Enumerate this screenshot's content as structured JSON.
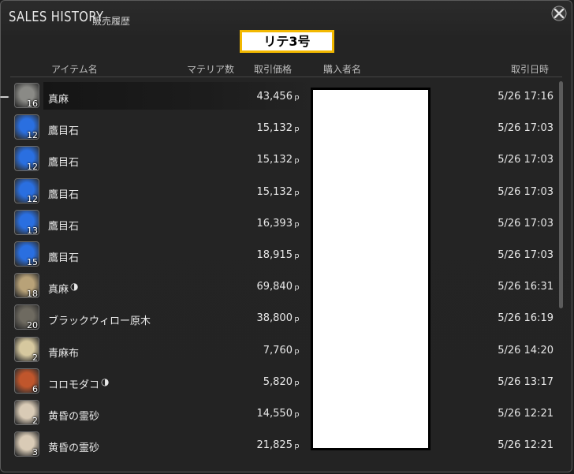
{
  "window": {
    "title": "SALES HISTORY",
    "subtitle": "販売履歴"
  },
  "banner": {
    "text": "リテ3号"
  },
  "columns": {
    "item": "アイテム名",
    "materia": "マテリア数",
    "price": "取引価格",
    "buyer": "購入者名",
    "date": "取引日時"
  },
  "currency_symbol": "ｐ",
  "hq_symbol": "◑",
  "rows": [
    {
      "name": "真麻",
      "qty": "16",
      "price": "43,456",
      "date": "5/26 17:16",
      "hq": false,
      "icon": "flax-icon",
      "color": "#8a8a86"
    },
    {
      "name": "鷹目石",
      "qty": "12",
      "price": "15,132",
      "date": "5/26 17:03",
      "hq": false,
      "icon": "blue-crystal-icon",
      "color": "#2a6fe0"
    },
    {
      "name": "鷹目石",
      "qty": "12",
      "price": "15,132",
      "date": "5/26 17:03",
      "hq": false,
      "icon": "blue-crystal-icon",
      "color": "#2a6fe0"
    },
    {
      "name": "鷹目石",
      "qty": "12",
      "price": "15,132",
      "date": "5/26 17:03",
      "hq": false,
      "icon": "blue-crystal-icon",
      "color": "#2a6fe0"
    },
    {
      "name": "鷹目石",
      "qty": "13",
      "price": "16,393",
      "date": "5/26 17:03",
      "hq": false,
      "icon": "blue-crystal-icon",
      "color": "#2a6fe0"
    },
    {
      "name": "鷹目石",
      "qty": "15",
      "price": "18,915",
      "date": "5/26 17:03",
      "hq": false,
      "icon": "blue-crystal-icon",
      "color": "#2a6fe0"
    },
    {
      "name": "真麻",
      "qty": "18",
      "price": "69,840",
      "date": "5/26 16:31",
      "hq": true,
      "icon": "flax-icon",
      "color": "#b8a278"
    },
    {
      "name": "ブラックウィロー原木",
      "qty": "20",
      "price": "38,800",
      "date": "5/26 16:19",
      "hq": false,
      "icon": "log-icon",
      "color": "#6e6a60"
    },
    {
      "name": "青麻布",
      "qty": "2",
      "price": "7,760",
      "date": "5/26 14:20",
      "hq": false,
      "icon": "cloth-icon",
      "color": "#d6c89f"
    },
    {
      "name": "コロモダコ",
      "qty": "6",
      "price": "5,820",
      "date": "5/26 13:17",
      "hq": true,
      "icon": "octopus-icon",
      "color": "#c0562c"
    },
    {
      "name": "黄昏の霊砂",
      "qty": "2",
      "price": "14,550",
      "date": "5/26 12:21",
      "hq": false,
      "icon": "sand-icon",
      "color": "#d9cbb6"
    },
    {
      "name": "黄昏の霊砂",
      "qty": "3",
      "price": "21,825",
      "date": "5/26 12:21",
      "hq": false,
      "icon": "sand-icon",
      "color": "#d9cbb6"
    }
  ]
}
